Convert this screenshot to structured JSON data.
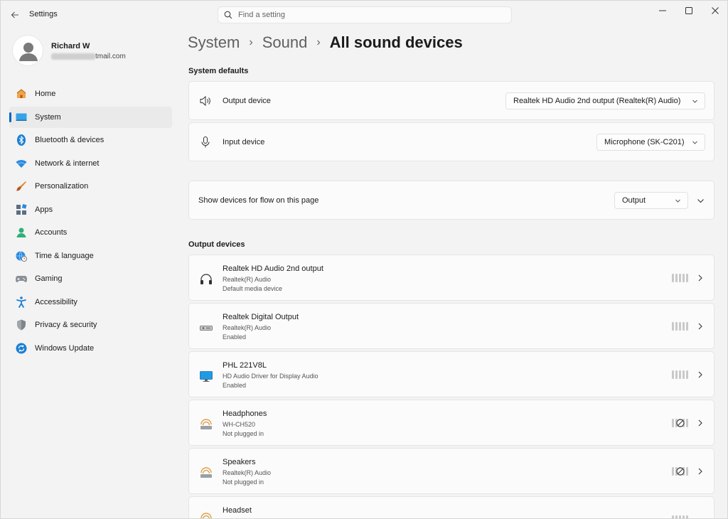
{
  "window": {
    "title": "Settings"
  },
  "search": {
    "placeholder": "Find a setting",
    "value": ""
  },
  "user": {
    "name": "Richard W",
    "email_suffix": "tmail.com"
  },
  "nav": [
    {
      "label": "Home",
      "icon": "home-icon"
    },
    {
      "label": "System",
      "icon": "system-icon",
      "active": true
    },
    {
      "label": "Bluetooth & devices",
      "icon": "bluetooth-icon"
    },
    {
      "label": "Network & internet",
      "icon": "wifi-icon"
    },
    {
      "label": "Personalization",
      "icon": "brush-icon"
    },
    {
      "label": "Apps",
      "icon": "apps-icon"
    },
    {
      "label": "Accounts",
      "icon": "accounts-icon"
    },
    {
      "label": "Time & language",
      "icon": "globe-clock-icon"
    },
    {
      "label": "Gaming",
      "icon": "gamepad-icon"
    },
    {
      "label": "Accessibility",
      "icon": "accessibility-icon"
    },
    {
      "label": "Privacy & security",
      "icon": "shield-icon"
    },
    {
      "label": "Windows Update",
      "icon": "update-icon"
    }
  ],
  "breadcrumb": {
    "first": "System",
    "second": "Sound",
    "current": "All sound devices",
    "separator": "›"
  },
  "defaults": {
    "title": "System defaults",
    "output_label": "Output device",
    "output_value": "Realtek HD Audio 2nd output (Realtek(R) Audio)",
    "input_label": "Input device",
    "input_value": "Microphone (SK-C201)"
  },
  "flow": {
    "label": "Show devices for flow on this page",
    "value": "Output"
  },
  "output_devices": {
    "title": "Output devices",
    "items": [
      {
        "name": "Realtek HD Audio 2nd output",
        "driver": "Realtek(R) Audio",
        "status": "Default media device",
        "icon": "headphones-icon",
        "unplugged": false
      },
      {
        "name": "Realtek Digital Output",
        "driver": "Realtek(R) Audio",
        "status": "Enabled",
        "icon": "digital-output-icon",
        "unplugged": false
      },
      {
        "name": "PHL 221V8L",
        "driver": "HD Audio Driver for Display Audio",
        "status": "Enabled",
        "icon": "monitor-icon",
        "unplugged": false
      },
      {
        "name": "Headphones",
        "driver": "WH-CH520",
        "status": "Not plugged in",
        "icon": "bluetooth-audio-icon",
        "unplugged": true
      },
      {
        "name": "Speakers",
        "driver": "Realtek(R) Audio",
        "status": "Not plugged in",
        "icon": "bluetooth-audio-icon",
        "unplugged": true
      },
      {
        "name": "Headset",
        "driver": "",
        "status": "",
        "icon": "bluetooth-audio-icon",
        "unplugged": true
      }
    ]
  },
  "colors": {
    "accent": "#0067c0",
    "background": "#f3f3f3",
    "card": "#fbfbfb"
  }
}
